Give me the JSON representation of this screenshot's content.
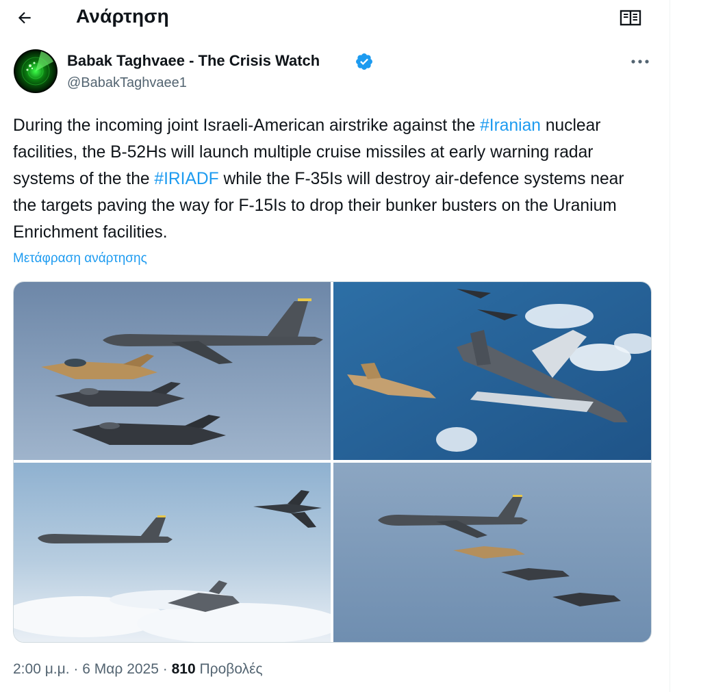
{
  "header": {
    "title": "Ανάρτηση"
  },
  "author": {
    "name": "Babak Taghvaee - The Crisis Watch",
    "handle": "@BabakTaghvaee1"
  },
  "tweet": {
    "text_1": "During the incoming joint Israeli-American airstrike against the ",
    "hashtag_1": "#Iranian",
    "text_2": " nuclear facilities, the B-52Hs will launch multiple cruise missiles at early warning radar systems of the the ",
    "hashtag_2": "#IRIADF",
    "text_3": " while the F-35Is will destroy air-defence systems near the targets paving the way for F-15Is to drop their bunker busters on the Uranium Enrichment facilities.",
    "translate_label": "Μετάφραση ανάρτησης"
  },
  "meta": {
    "time": "2:00 μ.μ.",
    "sep": "·",
    "date": "6 Μαρ 2025",
    "views_count": "810",
    "views_label": "Προβολές"
  },
  "colors": {
    "accent": "#1d9bf0",
    "text": "#0f1419",
    "secondary": "#536471",
    "border": "#cfd9de"
  },
  "icons": [
    "back-arrow-icon",
    "reader-book-icon",
    "verified-badge-icon",
    "more-dots-icon"
  ]
}
